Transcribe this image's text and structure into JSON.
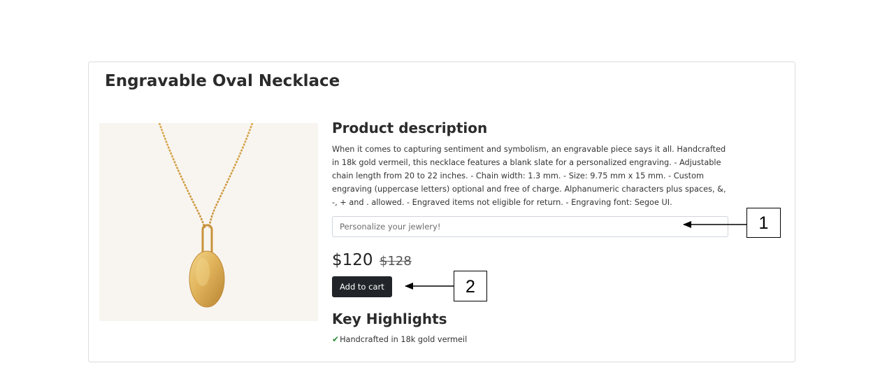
{
  "product": {
    "title": "Engravable Oval Necklace",
    "description_heading": "Product description",
    "description": "When it comes to capturing sentiment and symbolism, an engravable piece says it all. Handcrafted in 18k gold vermeil, this necklace features a blank slate for a personalized engraving. - Adjustable chain length from 20 to 22 inches. - Chain width: 1.3 mm. - Size: 9.75 mm x 15 mm. - Custom engraving (uppercase letters) optional and free of charge. Alphanumeric characters plus spaces, &, -, + and . allowed. - Engraved items not eligible for return. - Engraving font: Segoe UI.",
    "engraving_input": {
      "placeholder": "Personalize your jewlery!",
      "value": ""
    },
    "price_current": "$120",
    "price_original": "$128",
    "add_to_cart_label": "Add to cart",
    "highlights_heading": "Key Highlights",
    "highlights": [
      {
        "icon": "check-icon",
        "text": "Handcrafted in 18k gold vermeil"
      }
    ],
    "image_icon": "oval-necklace-image"
  },
  "annotations": [
    {
      "label": "1",
      "target": "engraving-input"
    },
    {
      "label": "2",
      "target": "add-to-cart-button"
    }
  ],
  "colors": {
    "button_bg": "#212529",
    "check": "#2e8b3a",
    "image_bg": "#f8f5f0",
    "gold": "#d8a94a"
  }
}
